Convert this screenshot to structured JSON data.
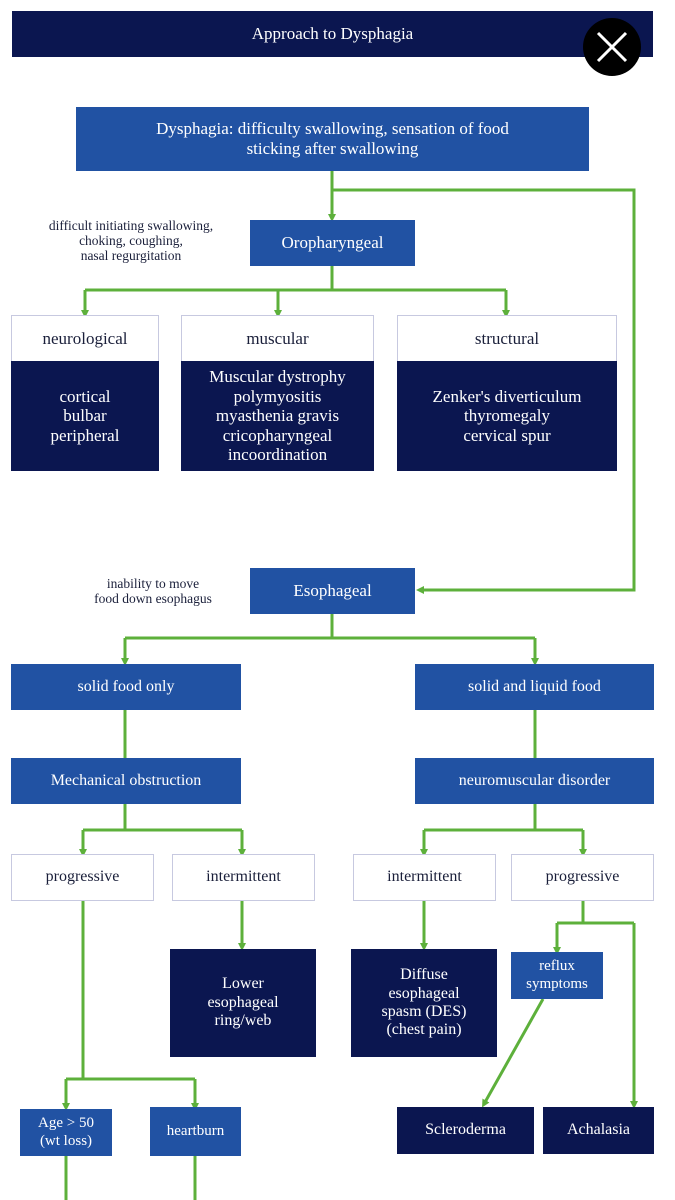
{
  "header": {
    "title": "Approach to Dysphagia",
    "close_icon": "close-x-icon"
  },
  "colors": {
    "header": "#0b1650",
    "medium_box": "#2152a3",
    "dark_box": "#0b1650",
    "connector": "#5db03b",
    "light_border": "#c7c9e0"
  },
  "root": {
    "label": "Dysphagia: difficulty swallowing, sensation of food\nsticking after swallowing"
  },
  "oropharyngeal": {
    "label": "Oropharyngeal",
    "note": "difficult initiating swallowing,\nchoking, coughing,\nnasal regurgitation",
    "categories": [
      {
        "label": "neurological",
        "detail": "cortical\nbulbar\nperipheral"
      },
      {
        "label": "muscular",
        "detail": "Muscular dystrophy\npolymyositis\nmyasthenia gravis\ncricopharyngeal\nincoordination"
      },
      {
        "label": "structural",
        "detail": "Zenker's diverticulum\nthyromegaly\ncervical spur"
      }
    ]
  },
  "esophageal": {
    "label": "Esophageal",
    "note": "inability to move\nfood down esophagus",
    "solid": {
      "label": "solid food only",
      "type": "Mechanical obstruction",
      "progressive": {
        "label": "progressive",
        "children": [
          "Age > 50\n(wt loss)",
          "heartburn"
        ]
      },
      "intermittent": {
        "label": "intermittent",
        "result": "Lower\nesophageal\nring/web"
      }
    },
    "solid_liquid": {
      "label": "solid and liquid food",
      "type": "neuromuscular disorder",
      "intermittent": {
        "label": "intermittent",
        "result": "Diffuse\nesophageal\nspasm (DES)\n(chest pain)"
      },
      "progressive": {
        "label": "progressive",
        "reflux": "reflux\nsymptoms",
        "results": [
          "Scleroderma",
          "Achalasia"
        ]
      }
    }
  }
}
